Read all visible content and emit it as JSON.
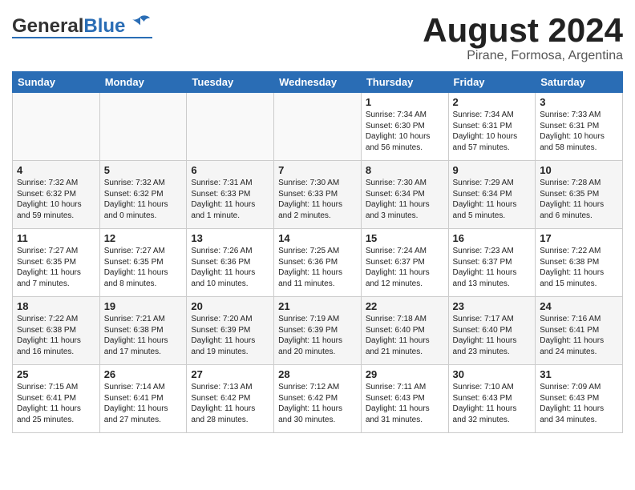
{
  "header": {
    "logo_general": "General",
    "logo_blue": "Blue",
    "month_year": "August 2024",
    "location": "Pirane, Formosa, Argentina"
  },
  "days_of_week": [
    "Sunday",
    "Monday",
    "Tuesday",
    "Wednesday",
    "Thursday",
    "Friday",
    "Saturday"
  ],
  "weeks": [
    [
      {
        "day": "",
        "info": ""
      },
      {
        "day": "",
        "info": ""
      },
      {
        "day": "",
        "info": ""
      },
      {
        "day": "",
        "info": ""
      },
      {
        "day": "1",
        "info": "Sunrise: 7:34 AM\nSunset: 6:30 PM\nDaylight: 10 hours and 56 minutes."
      },
      {
        "day": "2",
        "info": "Sunrise: 7:34 AM\nSunset: 6:31 PM\nDaylight: 10 hours and 57 minutes."
      },
      {
        "day": "3",
        "info": "Sunrise: 7:33 AM\nSunset: 6:31 PM\nDaylight: 10 hours and 58 minutes."
      }
    ],
    [
      {
        "day": "4",
        "info": "Sunrise: 7:32 AM\nSunset: 6:32 PM\nDaylight: 10 hours and 59 minutes."
      },
      {
        "day": "5",
        "info": "Sunrise: 7:32 AM\nSunset: 6:32 PM\nDaylight: 11 hours and 0 minutes."
      },
      {
        "day": "6",
        "info": "Sunrise: 7:31 AM\nSunset: 6:33 PM\nDaylight: 11 hours and 1 minute."
      },
      {
        "day": "7",
        "info": "Sunrise: 7:30 AM\nSunset: 6:33 PM\nDaylight: 11 hours and 2 minutes."
      },
      {
        "day": "8",
        "info": "Sunrise: 7:30 AM\nSunset: 6:34 PM\nDaylight: 11 hours and 3 minutes."
      },
      {
        "day": "9",
        "info": "Sunrise: 7:29 AM\nSunset: 6:34 PM\nDaylight: 11 hours and 5 minutes."
      },
      {
        "day": "10",
        "info": "Sunrise: 7:28 AM\nSunset: 6:35 PM\nDaylight: 11 hours and 6 minutes."
      }
    ],
    [
      {
        "day": "11",
        "info": "Sunrise: 7:27 AM\nSunset: 6:35 PM\nDaylight: 11 hours and 7 minutes."
      },
      {
        "day": "12",
        "info": "Sunrise: 7:27 AM\nSunset: 6:35 PM\nDaylight: 11 hours and 8 minutes."
      },
      {
        "day": "13",
        "info": "Sunrise: 7:26 AM\nSunset: 6:36 PM\nDaylight: 11 hours and 10 minutes."
      },
      {
        "day": "14",
        "info": "Sunrise: 7:25 AM\nSunset: 6:36 PM\nDaylight: 11 hours and 11 minutes."
      },
      {
        "day": "15",
        "info": "Sunrise: 7:24 AM\nSunset: 6:37 PM\nDaylight: 11 hours and 12 minutes."
      },
      {
        "day": "16",
        "info": "Sunrise: 7:23 AM\nSunset: 6:37 PM\nDaylight: 11 hours and 13 minutes."
      },
      {
        "day": "17",
        "info": "Sunrise: 7:22 AM\nSunset: 6:38 PM\nDaylight: 11 hours and 15 minutes."
      }
    ],
    [
      {
        "day": "18",
        "info": "Sunrise: 7:22 AM\nSunset: 6:38 PM\nDaylight: 11 hours and 16 minutes."
      },
      {
        "day": "19",
        "info": "Sunrise: 7:21 AM\nSunset: 6:38 PM\nDaylight: 11 hours and 17 minutes."
      },
      {
        "day": "20",
        "info": "Sunrise: 7:20 AM\nSunset: 6:39 PM\nDaylight: 11 hours and 19 minutes."
      },
      {
        "day": "21",
        "info": "Sunrise: 7:19 AM\nSunset: 6:39 PM\nDaylight: 11 hours and 20 minutes."
      },
      {
        "day": "22",
        "info": "Sunrise: 7:18 AM\nSunset: 6:40 PM\nDaylight: 11 hours and 21 minutes."
      },
      {
        "day": "23",
        "info": "Sunrise: 7:17 AM\nSunset: 6:40 PM\nDaylight: 11 hours and 23 minutes."
      },
      {
        "day": "24",
        "info": "Sunrise: 7:16 AM\nSunset: 6:41 PM\nDaylight: 11 hours and 24 minutes."
      }
    ],
    [
      {
        "day": "25",
        "info": "Sunrise: 7:15 AM\nSunset: 6:41 PM\nDaylight: 11 hours and 25 minutes."
      },
      {
        "day": "26",
        "info": "Sunrise: 7:14 AM\nSunset: 6:41 PM\nDaylight: 11 hours and 27 minutes."
      },
      {
        "day": "27",
        "info": "Sunrise: 7:13 AM\nSunset: 6:42 PM\nDaylight: 11 hours and 28 minutes."
      },
      {
        "day": "28",
        "info": "Sunrise: 7:12 AM\nSunset: 6:42 PM\nDaylight: 11 hours and 30 minutes."
      },
      {
        "day": "29",
        "info": "Sunrise: 7:11 AM\nSunset: 6:43 PM\nDaylight: 11 hours and 31 minutes."
      },
      {
        "day": "30",
        "info": "Sunrise: 7:10 AM\nSunset: 6:43 PM\nDaylight: 11 hours and 32 minutes."
      },
      {
        "day": "31",
        "info": "Sunrise: 7:09 AM\nSunset: 6:43 PM\nDaylight: 11 hours and 34 minutes."
      }
    ]
  ]
}
